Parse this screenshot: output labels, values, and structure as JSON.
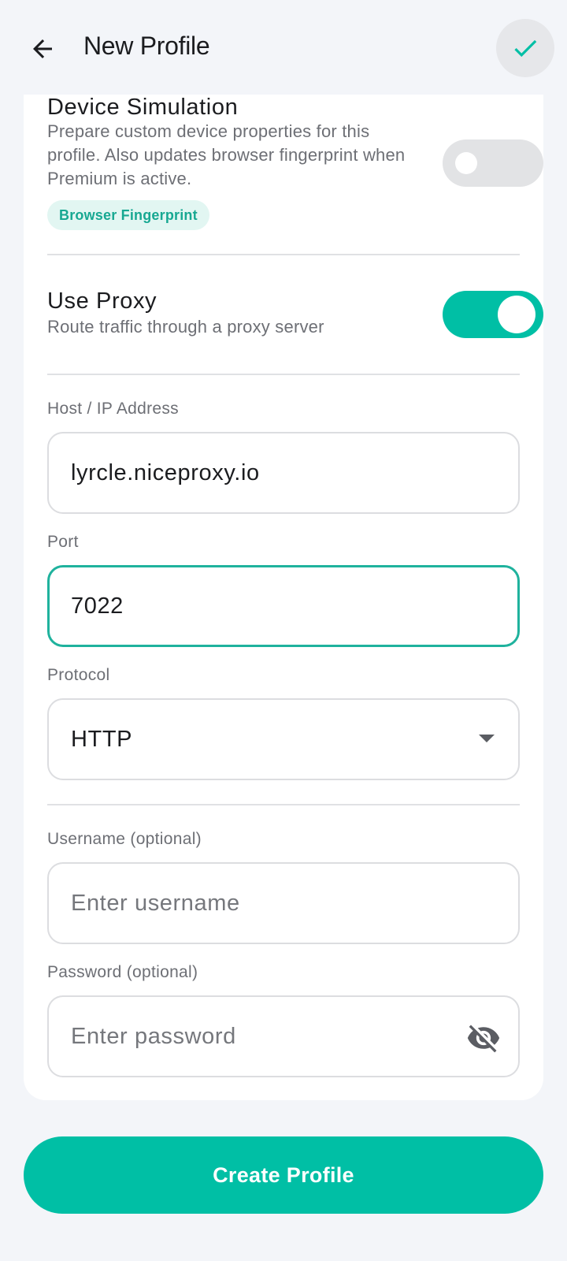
{
  "app_bar": {
    "title": "New Profile",
    "back_icon": "arrow-left-icon",
    "confirm_icon": "check-icon"
  },
  "device_simulation": {
    "title": "Device Simulation",
    "description_lines": [
      "Prepare custom device properties for this",
      "profile. Also updates browser fingerprint when",
      "Premium is active."
    ],
    "chip_label": "Browser Fingerprint",
    "enabled": false
  },
  "use_proxy": {
    "title": "Use Proxy",
    "description": "Route traffic through a proxy server",
    "enabled": true
  },
  "host": {
    "label": "Host / IP Address",
    "value": "lyrcle.niceproxy.io"
  },
  "port": {
    "label": "Port",
    "value": "7022"
  },
  "protocol": {
    "label": "Protocol",
    "selected": "HTTP"
  },
  "username": {
    "label": "Username (optional)",
    "placeholder": "Enter username",
    "value": ""
  },
  "password": {
    "label": "Password (optional)",
    "placeholder": "Enter password",
    "value": "",
    "visibility_icon": "eye-off-icon"
  },
  "create_button": {
    "label": "Create Profile"
  },
  "colors": {
    "accent": "#00bfa5",
    "background": "#f3f5f9",
    "card": "#ffffff",
    "chip_bg": "#e2f6f2"
  }
}
